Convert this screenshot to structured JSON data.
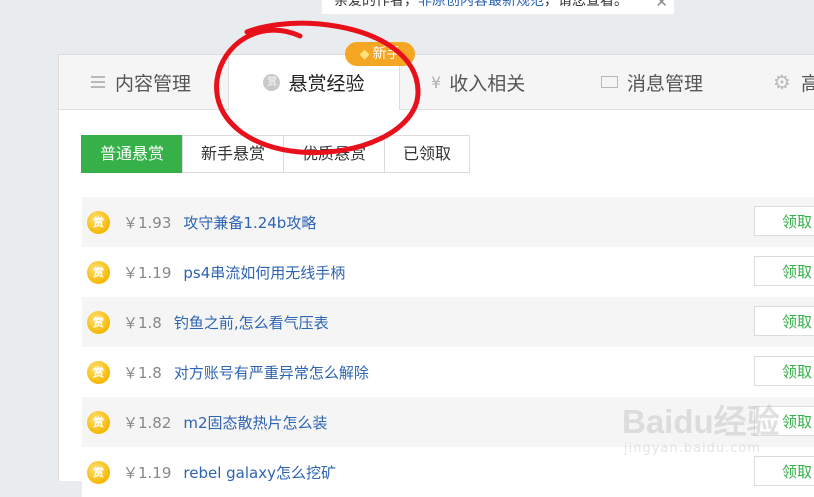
{
  "notice": {
    "text_prefix": "亲爱的作者，",
    "link": "非原创内容最新规范",
    "text_suffix": "，请您查看。",
    "close_label": "✕"
  },
  "tabs": [
    {
      "label": "内容管理",
      "icon": "list-icon",
      "active": false
    },
    {
      "label": "悬赏经验",
      "icon": "reward-coin-icon",
      "active": true,
      "badge": "新手"
    },
    {
      "label": "收入相关",
      "icon": "yen-icon",
      "active": false
    },
    {
      "label": "消息管理",
      "icon": "mail-icon",
      "active": false
    },
    {
      "label": "高",
      "icon": "gear-icon",
      "active": false
    }
  ],
  "subtabs": [
    {
      "label": "普通悬赏",
      "active": true
    },
    {
      "label": "新手悬赏",
      "active": false
    },
    {
      "label": "优质悬赏",
      "active": false
    },
    {
      "label": "已领取",
      "active": false
    }
  ],
  "rows": [
    {
      "badge": "赏",
      "amount": "￥1.93",
      "title": "攻守兼备1.24b攻略",
      "action": "领取"
    },
    {
      "badge": "赏",
      "amount": "￥1.19",
      "title": "ps4串流如何用无线手柄",
      "action": "领取"
    },
    {
      "badge": "赏",
      "amount": "￥1.8",
      "title": "钓鱼之前,怎么看气压表",
      "action": "领取"
    },
    {
      "badge": "赏",
      "amount": "￥1.8",
      "title": "对方账号有严重异常怎么解除",
      "action": "领取"
    },
    {
      "badge": "赏",
      "amount": "￥1.82",
      "title": "m2固态散热片怎么装",
      "action": "领取"
    },
    {
      "badge": "赏",
      "amount": "￥1.19",
      "title": "rebel galaxy怎么挖矿",
      "action": "领取"
    }
  ],
  "watermark": {
    "main": "Baidu经验",
    "sub": "jingyan.baidu.com"
  },
  "colors": {
    "accent_green": "#36b149",
    "link_blue": "#2d64b3",
    "badge_orange": "#f5a623",
    "annotation_red": "#e8111b"
  }
}
